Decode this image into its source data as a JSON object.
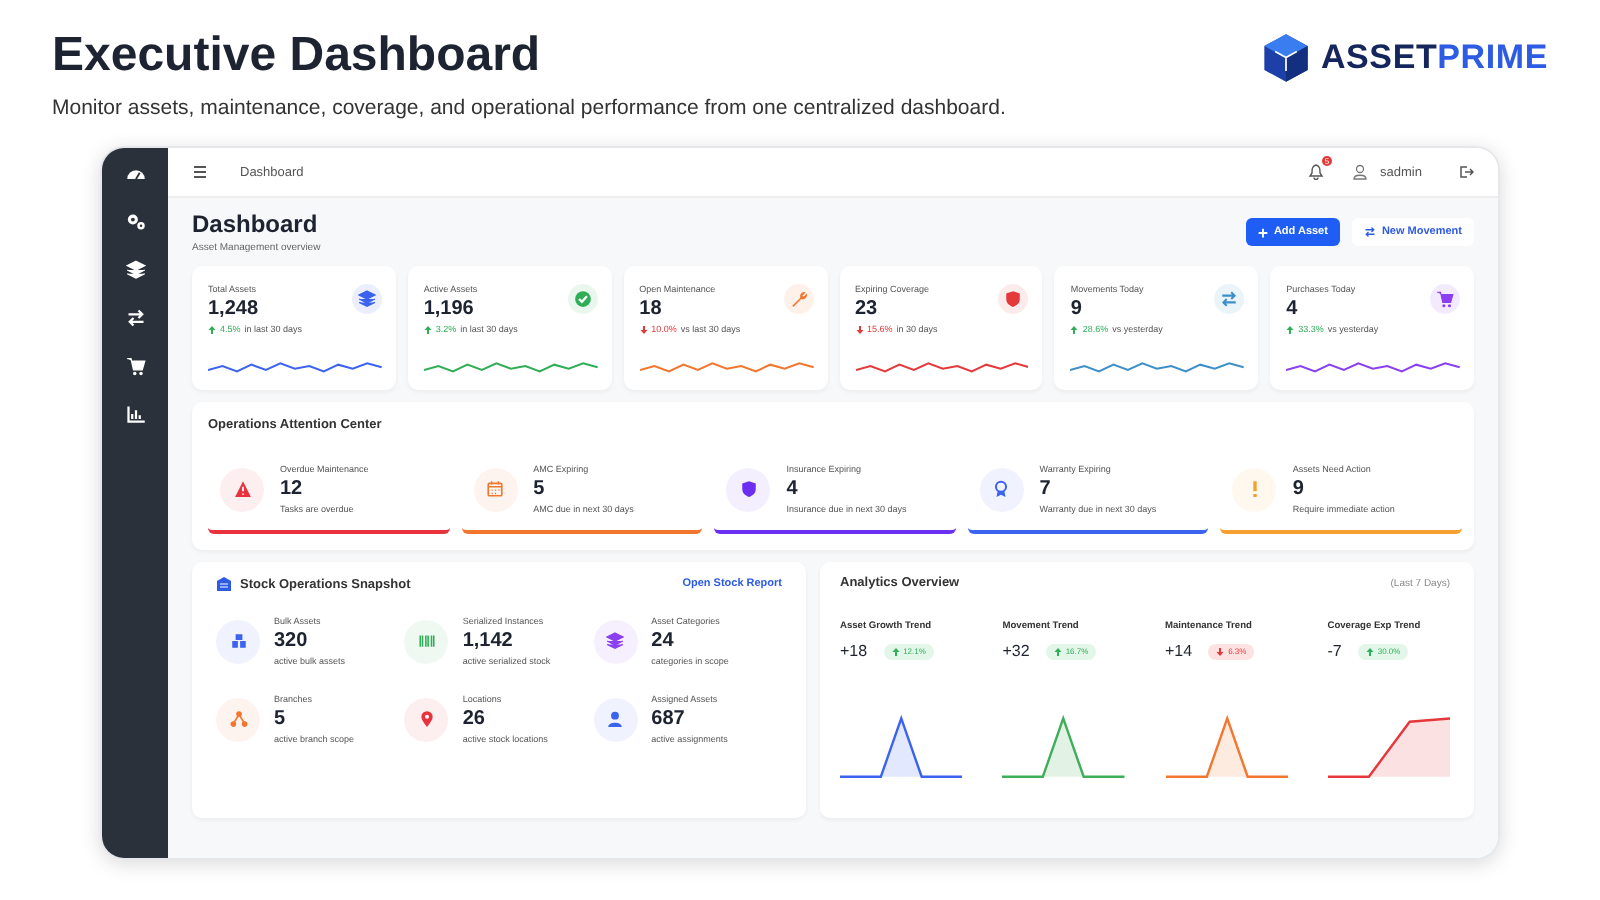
{
  "header": {
    "title": "Executive Dashboard",
    "subtitle": "Monitor assets, maintenance, coverage, and operational performance from one centralized dashboard.",
    "brand_first": "ASSET",
    "brand_second": "PRIME"
  },
  "topbar": {
    "breadcrumb": "Dashboard",
    "notifications": "5",
    "user": "sadmin"
  },
  "page": {
    "title": "Dashboard",
    "subtitle": "Asset Management overview",
    "buttons": [
      {
        "label": "Add Asset",
        "kind": "primary"
      },
      {
        "label": "New Movement",
        "kind": "secondary"
      }
    ]
  },
  "kpis": [
    {
      "label": "Total Assets",
      "value": "1,248",
      "change": "4.5%",
      "note": "in last 30 days",
      "rising": true,
      "kind": "layers",
      "color": "#3b63f0"
    },
    {
      "label": "Active Assets",
      "value": "1,196",
      "change": "3.2%",
      "note": "in last 30 days",
      "rising": true,
      "kind": "check",
      "color": "#2fae57"
    },
    {
      "label": "Open Maintenance",
      "value": "18",
      "change": "10.0%",
      "note": "vs last 30 days",
      "rising": false,
      "kind": "wrench",
      "color": "#f2762e"
    },
    {
      "label": "Expiring Coverage",
      "value": "23",
      "change": "15.6%",
      "note": "in 30 days",
      "rising": false,
      "kind": "shield",
      "color": "#e5383b"
    },
    {
      "label": "Movements Today",
      "value": "9",
      "change": "28.6%",
      "note": "vs yesterday",
      "rising": true,
      "kind": "swap",
      "color": "#3d8fc9"
    },
    {
      "label": "Purchases Today",
      "value": "4",
      "change": "33.3%",
      "note": "vs yesterday",
      "rising": true,
      "kind": "cart",
      "color": "#8a3ff0"
    }
  ],
  "attention": {
    "title": "Operations Attention Center",
    "items": [
      {
        "label": "Overdue Maintenance",
        "value": "12",
        "note": "Tasks are overdue",
        "kind": "warning",
        "color": "#e8323c"
      },
      {
        "label": "AMC Expiring",
        "value": "5",
        "note": "AMC due in next 30 days",
        "kind": "calendar",
        "color": "#f2762e"
      },
      {
        "label": "Insurance Expiring",
        "value": "4",
        "note": "Insurance due in next 30 days",
        "kind": "shield",
        "color": "#6a2ff0"
      },
      {
        "label": "Warranty Expiring",
        "value": "7",
        "note": "Warranty due in next 30 days",
        "kind": "award",
        "color": "#3b63f0"
      },
      {
        "label": "Assets Need Action",
        "value": "9",
        "note": "Require immediate action",
        "kind": "exclaim",
        "color": "#f5a030"
      }
    ]
  },
  "stock": {
    "title": "Stock Operations Snapshot",
    "link": "Open Stock Report",
    "items": [
      {
        "label": "Bulk Assets",
        "value": "320",
        "note": "active bulk assets",
        "kind": "boxes",
        "color": "#3b63f0"
      },
      {
        "label": "Serialized Instances",
        "value": "1,142",
        "note": "active serialized stock",
        "kind": "barcode",
        "color": "#2fae57"
      },
      {
        "label": "Asset Categories",
        "value": "24",
        "note": "categories in scope",
        "kind": "layers",
        "color": "#8a3ff0"
      },
      {
        "label": "Branches",
        "value": "5",
        "note": "active branch scope",
        "kind": "branch",
        "color": "#f2762e"
      },
      {
        "label": "Locations",
        "value": "26",
        "note": "active stock locations",
        "kind": "pin",
        "color": "#e8323c"
      },
      {
        "label": "Assigned Assets",
        "value": "687",
        "note": "active assignments",
        "kind": "user",
        "color": "#3b63f0"
      }
    ]
  },
  "analytics": {
    "title": "Analytics Overview",
    "range": "(Last 7 Days)",
    "trends": [
      {
        "label": "Asset Growth Trend",
        "value": "+18",
        "change": "12.1%",
        "rising": true,
        "kind": "peak",
        "color": "#3b63f0"
      },
      {
        "label": "Movement Trend",
        "value": "+32",
        "change": "16.7%",
        "rising": true,
        "kind": "peak",
        "color": "#3fae5a"
      },
      {
        "label": "Maintenance Trend",
        "value": "+14",
        "change": "6.3%",
        "rising": false,
        "kind": "peak",
        "color": "#f2762e"
      },
      {
        "label": "Coverage Exp Trend",
        "value": "-7",
        "change": "30.0%",
        "rising": true,
        "kind": "rise",
        "color": "#e5383b"
      }
    ]
  }
}
